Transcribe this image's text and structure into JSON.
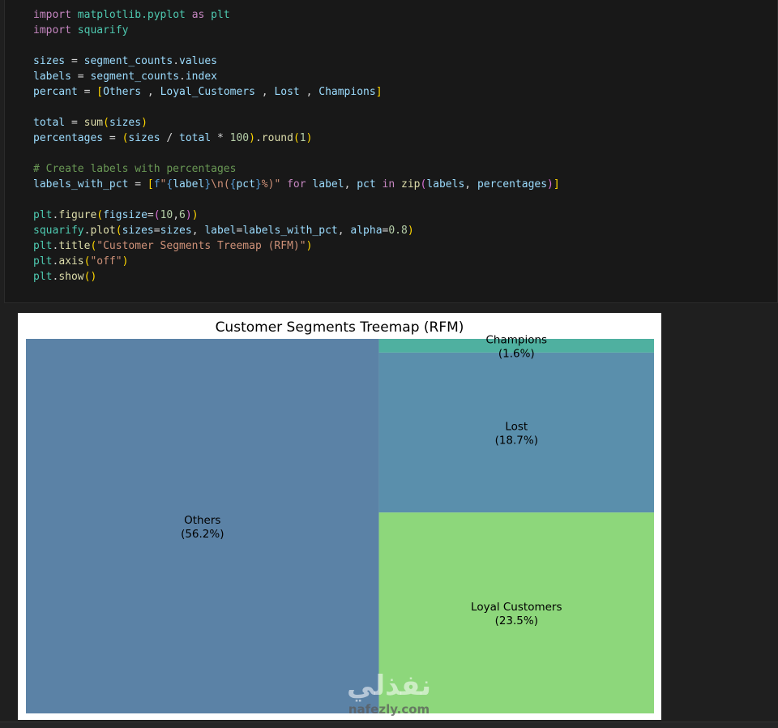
{
  "code_cell": {
    "lines": [
      [
        {
          "t": "import",
          "c": "kw"
        },
        {
          "t": " "
        },
        {
          "t": "matplotlib.pyplot",
          "c": "mod"
        },
        {
          "t": " "
        },
        {
          "t": "as",
          "c": "kw"
        },
        {
          "t": " "
        },
        {
          "t": "plt",
          "c": "mod"
        }
      ],
      [
        {
          "t": "import",
          "c": "kw"
        },
        {
          "t": " "
        },
        {
          "t": "squarify",
          "c": "mod"
        }
      ],
      [],
      [
        {
          "t": "sizes",
          "c": "var"
        },
        {
          "t": " = "
        },
        {
          "t": "segment_counts",
          "c": "var"
        },
        {
          "t": "."
        },
        {
          "t": "values",
          "c": "var"
        }
      ],
      [
        {
          "t": "labels",
          "c": "var"
        },
        {
          "t": " = "
        },
        {
          "t": "segment_counts",
          "c": "var"
        },
        {
          "t": "."
        },
        {
          "t": "index",
          "c": "var"
        }
      ],
      [
        {
          "t": "percant",
          "c": "var"
        },
        {
          "t": " = "
        },
        {
          "t": "[",
          "c": "brk"
        },
        {
          "t": "Others",
          "c": "var"
        },
        {
          "t": " , "
        },
        {
          "t": "Loyal_Customers",
          "c": "var"
        },
        {
          "t": " , "
        },
        {
          "t": "Lost",
          "c": "var"
        },
        {
          "t": " , "
        },
        {
          "t": "Champions",
          "c": "var"
        },
        {
          "t": "]",
          "c": "brk"
        }
      ],
      [],
      [
        {
          "t": "total",
          "c": "var"
        },
        {
          "t": " = "
        },
        {
          "t": "sum",
          "c": "fn"
        },
        {
          "t": "(",
          "c": "brk"
        },
        {
          "t": "sizes",
          "c": "var"
        },
        {
          "t": ")",
          "c": "brk"
        }
      ],
      [
        {
          "t": "percentages",
          "c": "var"
        },
        {
          "t": " = "
        },
        {
          "t": "(",
          "c": "brk"
        },
        {
          "t": "sizes",
          "c": "var"
        },
        {
          "t": " / "
        },
        {
          "t": "total",
          "c": "var"
        },
        {
          "t": " * "
        },
        {
          "t": "100",
          "c": "num"
        },
        {
          "t": ")",
          "c": "brk"
        },
        {
          "t": "."
        },
        {
          "t": "round",
          "c": "fn"
        },
        {
          "t": "(",
          "c": "brk"
        },
        {
          "t": "1",
          "c": "num"
        },
        {
          "t": ")",
          "c": "brk"
        }
      ],
      [],
      [
        {
          "t": "# Create labels with percentages",
          "c": "cmt"
        }
      ],
      [
        {
          "t": "labels_with_pct",
          "c": "var"
        },
        {
          "t": " = "
        },
        {
          "t": "[",
          "c": "brk"
        },
        {
          "t": "f",
          "c": "fkw"
        },
        {
          "t": "\"",
          "c": "str"
        },
        {
          "t": "{",
          "c": "fkw"
        },
        {
          "t": "label",
          "c": "var"
        },
        {
          "t": "}",
          "c": "fkw"
        },
        {
          "t": "\\n(",
          "c": "str"
        },
        {
          "t": "{",
          "c": "fkw"
        },
        {
          "t": "pct",
          "c": "var"
        },
        {
          "t": "}",
          "c": "fkw"
        },
        {
          "t": "%)\"",
          "c": "str"
        },
        {
          "t": " "
        },
        {
          "t": "for",
          "c": "kw"
        },
        {
          "t": " "
        },
        {
          "t": "label",
          "c": "var"
        },
        {
          "t": ", "
        },
        {
          "t": "pct",
          "c": "var"
        },
        {
          "t": " "
        },
        {
          "t": "in",
          "c": "kw"
        },
        {
          "t": " "
        },
        {
          "t": "zip",
          "c": "fn"
        },
        {
          "t": "(",
          "c": "brk2"
        },
        {
          "t": "labels",
          "c": "var"
        },
        {
          "t": ", "
        },
        {
          "t": "percentages",
          "c": "var"
        },
        {
          "t": ")",
          "c": "brk2"
        },
        {
          "t": "]",
          "c": "brk"
        }
      ],
      [],
      [
        {
          "t": "plt",
          "c": "mod"
        },
        {
          "t": "."
        },
        {
          "t": "figure",
          "c": "fn"
        },
        {
          "t": "(",
          "c": "brk"
        },
        {
          "t": "figsize",
          "c": "var"
        },
        {
          "t": "="
        },
        {
          "t": "(",
          "c": "brk2"
        },
        {
          "t": "10",
          "c": "num"
        },
        {
          "t": ","
        },
        {
          "t": "6",
          "c": "num"
        },
        {
          "t": ")",
          "c": "brk2"
        },
        {
          "t": ")",
          "c": "brk"
        }
      ],
      [
        {
          "t": "squarify",
          "c": "mod"
        },
        {
          "t": "."
        },
        {
          "t": "plot",
          "c": "fn"
        },
        {
          "t": "(",
          "c": "brk"
        },
        {
          "t": "sizes",
          "c": "var"
        },
        {
          "t": "="
        },
        {
          "t": "sizes",
          "c": "var"
        },
        {
          "t": ", "
        },
        {
          "t": "label",
          "c": "var"
        },
        {
          "t": "="
        },
        {
          "t": "labels_with_pct",
          "c": "var"
        },
        {
          "t": ", "
        },
        {
          "t": "alpha",
          "c": "var"
        },
        {
          "t": "="
        },
        {
          "t": "0.8",
          "c": "num"
        },
        {
          "t": ")",
          "c": "brk"
        }
      ],
      [
        {
          "t": "plt",
          "c": "mod"
        },
        {
          "t": "."
        },
        {
          "t": "title",
          "c": "fn"
        },
        {
          "t": "(",
          "c": "brk"
        },
        {
          "t": "\"Customer Segments Treemap (RFM)\"",
          "c": "str"
        },
        {
          "t": ")",
          "c": "brk"
        }
      ],
      [
        {
          "t": "plt",
          "c": "mod"
        },
        {
          "t": "."
        },
        {
          "t": "axis",
          "c": "fn"
        },
        {
          "t": "(",
          "c": "brk"
        },
        {
          "t": "\"off\"",
          "c": "str"
        },
        {
          "t": ")",
          "c": "brk"
        }
      ],
      [
        {
          "t": "plt",
          "c": "mod"
        },
        {
          "t": "."
        },
        {
          "t": "show",
          "c": "fn"
        },
        {
          "t": "()",
          "c": "brk"
        }
      ]
    ]
  },
  "colors": {
    "editor_bg": "#181818",
    "page_bg": "#1f1f1f"
  },
  "chart_data": {
    "type": "treemap",
    "title": "Customer Segments Treemap (RFM)",
    "axis": "off",
    "segments": [
      {
        "label": "Others",
        "pct_label": "(56.2%)",
        "value": 56.2,
        "color": "#5b82a6"
      },
      {
        "label": "Loyal Customers",
        "pct_label": "(23.5%)",
        "value": 23.5,
        "color": "#8dd77b"
      },
      {
        "label": "Lost",
        "pct_label": "(18.7%)",
        "value": 18.7,
        "color": "#5a8fac"
      },
      {
        "label": "Champions",
        "pct_label": "(1.6%)",
        "value": 1.6,
        "color": "#4fb0a0"
      }
    ]
  },
  "watermark": {
    "main": "نفذلي",
    "sub": "nafezly.com"
  }
}
